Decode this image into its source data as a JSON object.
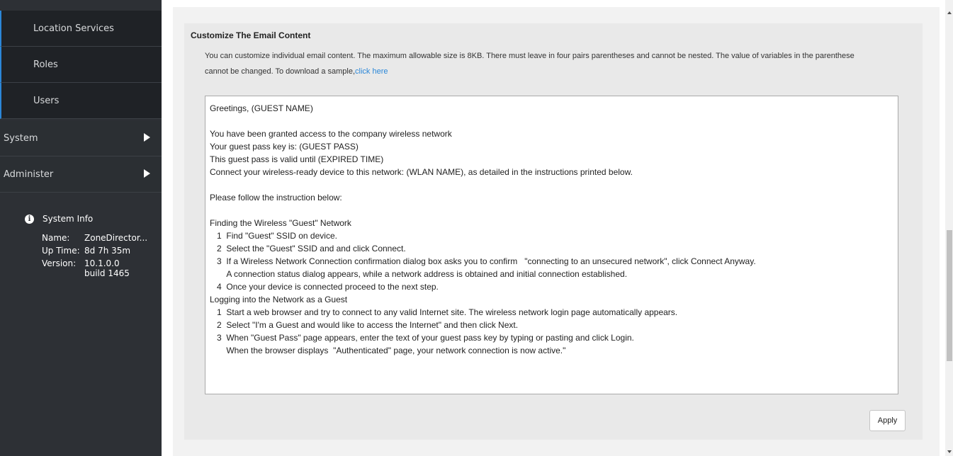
{
  "sidebar": {
    "sub_items": [
      {
        "label": "Location Services"
      },
      {
        "label": "Roles"
      },
      {
        "label": "Users"
      }
    ],
    "nav_items": [
      {
        "label": "System"
      },
      {
        "label": "Administer"
      }
    ],
    "system_info": {
      "title": "System Info",
      "rows": [
        {
          "key": "Name:",
          "value": "ZoneDirector..."
        },
        {
          "key": "Up Time:",
          "value": "8d 7h 35m"
        },
        {
          "key": "Version:",
          "value": "10.1.0.0 build 1465"
        }
      ]
    }
  },
  "email_section": {
    "title": "Customize The Email Content",
    "description_line1": "You can customize individual email content. The maximum allowable size is 8KB. There must leave in four pairs parentheses and cannot be nested. The value of variables in the parenthese",
    "description_line2": "cannot be changed. To download a sample,",
    "download_link": "click here",
    "content": "Greetings, (GUEST NAME)\n\nYou have been granted access to the company wireless network\nYour guest pass key is: (GUEST PASS)\nThis guest pass is valid until (EXPIRED TIME)\nConnect your wireless-ready device to this network: (WLAN NAME), as detailed in the instructions printed below.\n\nPlease follow the instruction below:\n\nFinding the Wireless \"Guest\" Network\n   1  Find \"Guest\" SSID on device.\n   2  Select the \"Guest\" SSID and and click Connect.\n   3  If a Wireless Network Connection confirmation dialog box asks you to confirm   \"connecting to an unsecured network\", click Connect Anyway.\n       A connection status dialog appears, while a network address is obtained and initial connection established.\n   4  Once your device is connected proceed to the next step.\nLogging into the Network as a Guest\n   1  Start a web browser and try to connect to any valid Internet site. The wireless network login page automatically appears.\n   2  Select \"I'm a Guest and would like to access the Internet\" and then click Next.\n   3  When \"Guest Pass\" page appears, enter the text of your guest pass key by typing or pasting and click Login.\n       When the browser displays  \"Authenticated\" page, your network connection is now active.\"",
    "apply_label": "Apply"
  }
}
